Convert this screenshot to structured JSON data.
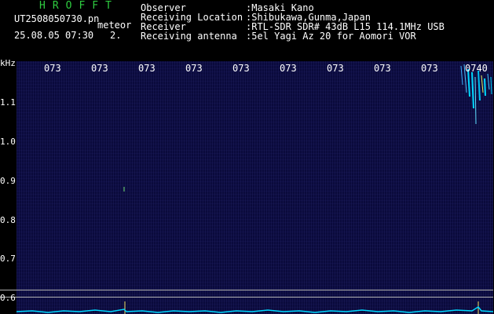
{
  "header": {
    "brand": "HROFFT",
    "filename": "UT2508050730.pn",
    "event_label": "meteor",
    "datetime": "25.08.05 07:30",
    "count": "2."
  },
  "info_rows": [
    {
      "label": "Observer",
      "value": ":Masaki Kano"
    },
    {
      "label": "Receiving Location",
      "value": ":Shibukawa,Gunma,Japan"
    },
    {
      "label": "Receiver",
      "value": ":RTL-SDR SDR# 43dB L15 114.1MHz USB"
    },
    {
      "label": "Receiving antenna",
      "value": ":5el Yagi Az 20 for Aomori VOR"
    }
  ],
  "y_axis": {
    "unit": "kHz",
    "ticks": [
      "1.1",
      "1.0",
      "0.9",
      "0.8",
      "0.7",
      "0.6"
    ]
  },
  "x_axis": {
    "ticks": [
      "073",
      "073",
      "073",
      "073",
      "073",
      "073",
      "073",
      "073",
      "073",
      "0740"
    ]
  },
  "colors": {
    "background": "#000000",
    "spectrogram": "#0a0a3c",
    "signal": "#00d8ff",
    "brand": "#2ecc40",
    "text": "#ffffff"
  }
}
